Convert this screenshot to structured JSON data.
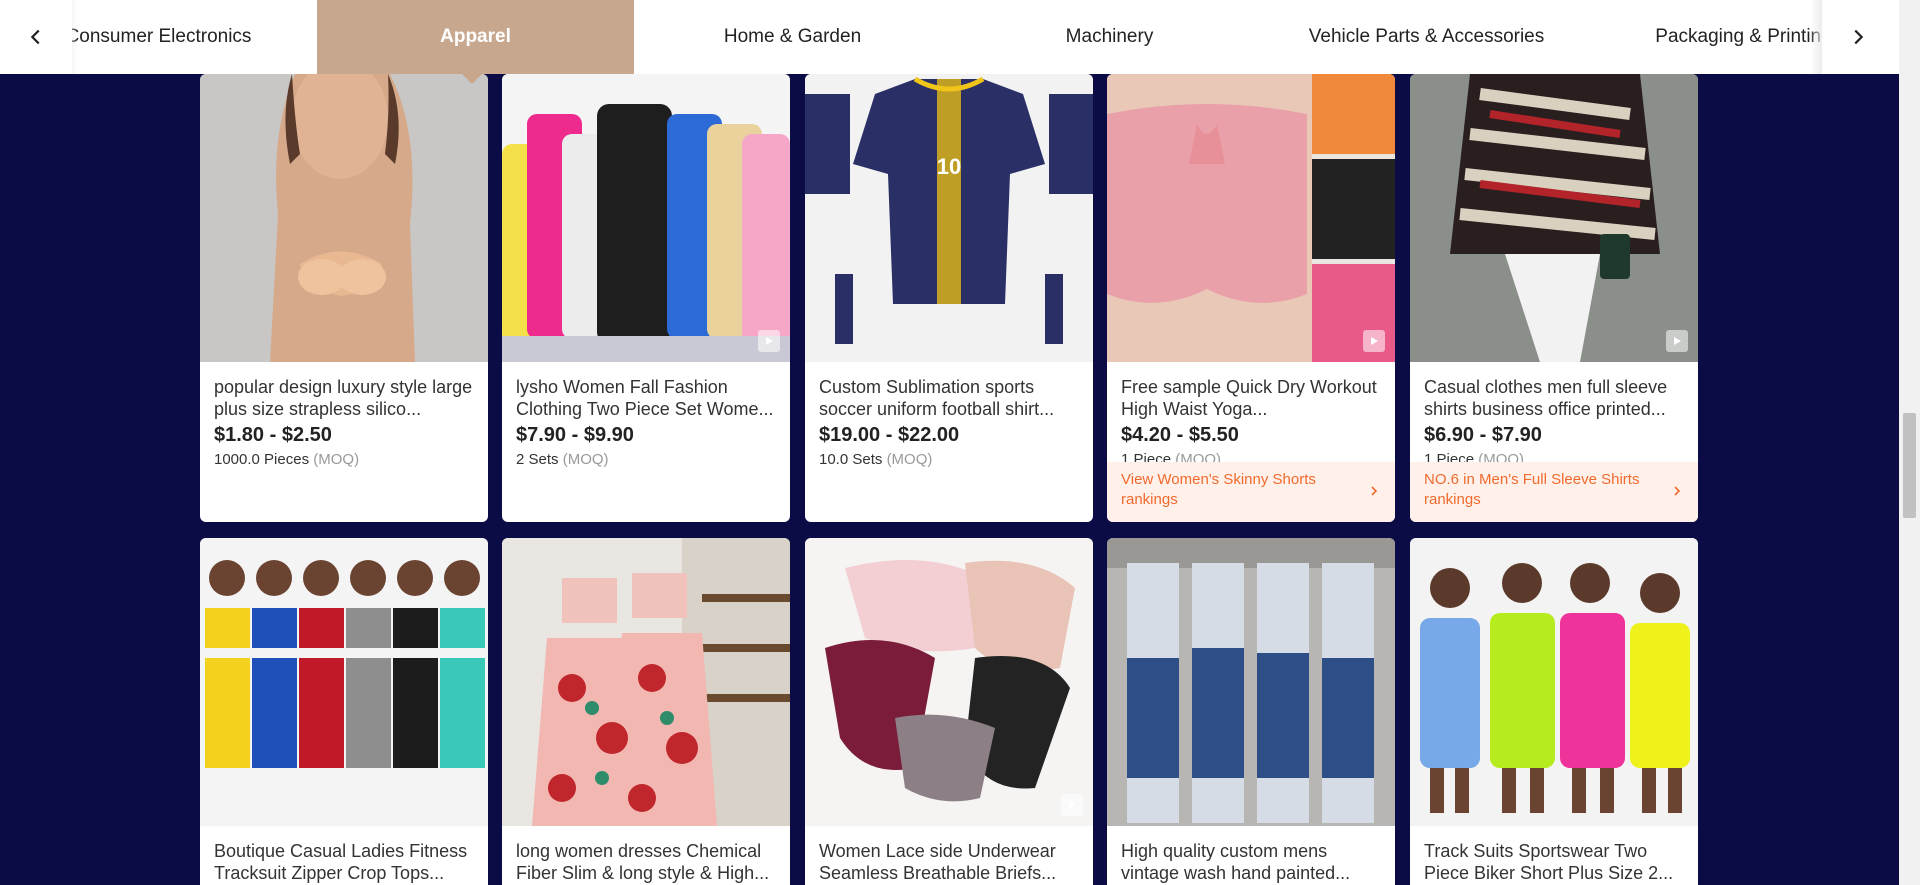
{
  "category_tabs": [
    {
      "label": "Consumer Electronics"
    },
    {
      "label": "Apparel"
    },
    {
      "label": "Home & Garden"
    },
    {
      "label": "Machinery"
    },
    {
      "label": "Vehicle Parts & Accessories"
    },
    {
      "label": "Packaging & Printing"
    }
  ],
  "active_tab": "Apparel",
  "colors": {
    "page_background": "#0b0b45",
    "active_tab": "#c7a88f",
    "ranking_text": "#f06a2e",
    "ranking_background": "#fff1ea"
  },
  "products": [
    {
      "title": "popular design luxury style large plus size strapless silico...",
      "price": "$1.80 - $2.50",
      "moq": "1000.0 Pieces",
      "moq_tag": "(MOQ)",
      "has_video": false
    },
    {
      "title": "lysho Women Fall Fashion Clothing Two Piece Set Wome...",
      "price": "$7.90 - $9.90",
      "moq": "2 Sets",
      "moq_tag": "(MOQ)",
      "has_video": true
    },
    {
      "title": "Custom Sublimation sports soccer uniform football shirt...",
      "price": "$19.00 - $22.00",
      "moq": "10.0 Sets",
      "moq_tag": "(MOQ)",
      "has_video": false
    },
    {
      "title": "Free sample Quick Dry Workout High Waist Yoga...",
      "price": "$4.20 - $5.50",
      "moq": "1 Piece",
      "moq_tag": "(MOQ)",
      "has_video": true,
      "ranking": "View Women's Skinny Shorts rankings"
    },
    {
      "title": "Casual clothes men full sleeve shirts business office printed...",
      "price": "$6.90 - $7.90",
      "moq": "1 Piece",
      "moq_tag": "(MOQ)",
      "has_video": true,
      "ranking": "NO.6 in Men's Full Sleeve Shirts rankings"
    },
    {
      "title": "Boutique Casual Ladies Fitness Tracksuit Zipper Crop Tops...",
      "has_video": false
    },
    {
      "title": "long women dresses Chemical Fiber Slim & long style & High...",
      "has_video": false
    },
    {
      "title": "Women Lace side Underwear Seamless Breathable Briefs...",
      "has_video": true
    },
    {
      "title": "High quality custom mens vintage wash hand painted...",
      "has_video": false
    },
    {
      "title": "Track Suits Sportswear Two Piece Biker Short Plus Size 2...",
      "has_video": false
    }
  ]
}
